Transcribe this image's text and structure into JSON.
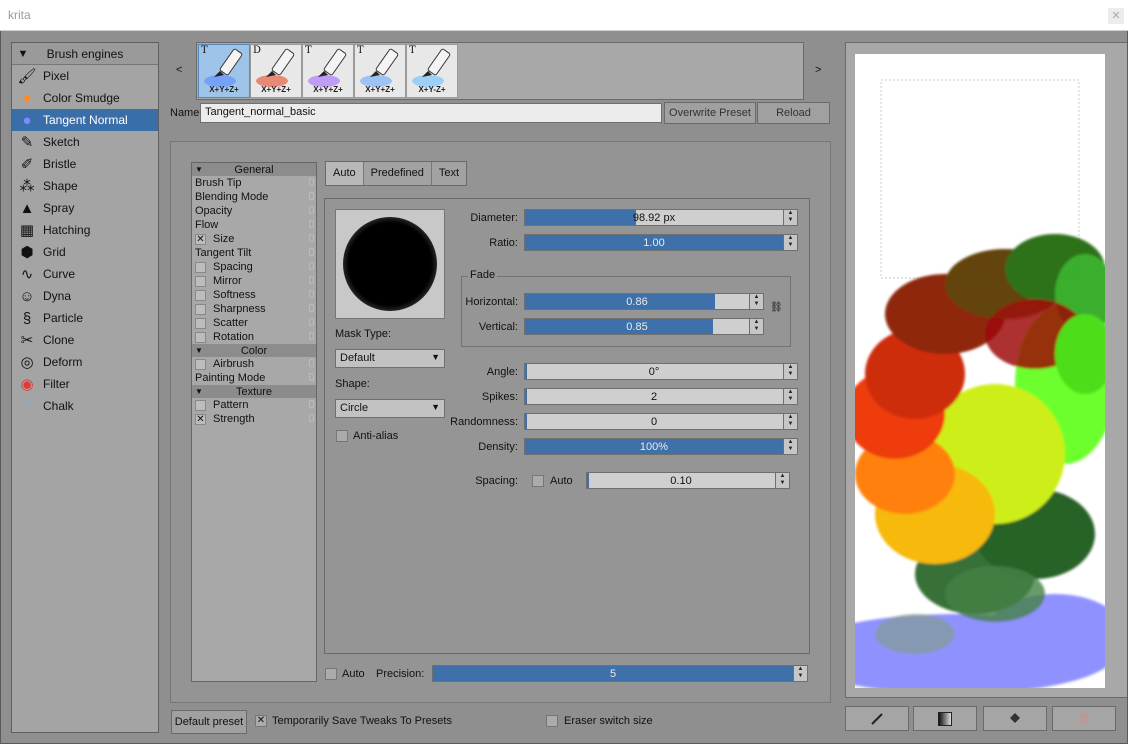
{
  "window": {
    "title": "krita"
  },
  "engines": {
    "header": "Brush engines",
    "items": [
      {
        "label": "Pixel",
        "icon": "pixel-brush-icon"
      },
      {
        "label": "Color Smudge",
        "icon": "color-smudge-icon"
      },
      {
        "label": "Tangent Normal",
        "icon": "tangent-normal-icon",
        "selected": true
      },
      {
        "label": "Sketch",
        "icon": "sketch-icon"
      },
      {
        "label": "Bristle",
        "icon": "bristle-icon"
      },
      {
        "label": "Shape",
        "icon": "shape-icon"
      },
      {
        "label": "Spray",
        "icon": "spray-icon"
      },
      {
        "label": "Hatching",
        "icon": "hatching-icon"
      },
      {
        "label": "Grid",
        "icon": "grid-icon"
      },
      {
        "label": "Curve",
        "icon": "curve-icon"
      },
      {
        "label": "Dyna",
        "icon": "dyna-icon"
      },
      {
        "label": "Particle",
        "icon": "particle-icon"
      },
      {
        "label": "Clone",
        "icon": "clone-icon"
      },
      {
        "label": "Deform",
        "icon": "deform-icon"
      },
      {
        "label": "Filter",
        "icon": "filter-icon"
      },
      {
        "label": "Chalk",
        "icon": "chalk-icon"
      }
    ]
  },
  "presets": {
    "prev": "<",
    "next": ">",
    "items": [
      {
        "tag": "T",
        "caption": "X+Y+Z+",
        "selected": true
      },
      {
        "tag": "D",
        "caption": "X+Y+Z+"
      },
      {
        "tag": "T",
        "caption": "X+Y+Z+"
      },
      {
        "tag": "T",
        "caption": "X+Y+Z+"
      },
      {
        "tag": "T",
        "caption": "X+Y-Z+"
      }
    ]
  },
  "name": {
    "label": "Name:",
    "value": "Tangent_normal_basic",
    "overwrite": "Overwrite Preset",
    "reload": "Reload"
  },
  "options": {
    "sections": [
      {
        "header": "General",
        "items": [
          {
            "label": "Brush Tip"
          },
          {
            "label": "Blending Mode"
          },
          {
            "label": "Opacity"
          },
          {
            "label": "Flow"
          },
          {
            "label": "Size",
            "checkbox": true,
            "checked": true
          },
          {
            "label": "Tangent Tilt"
          },
          {
            "label": "Spacing",
            "checkbox": true
          },
          {
            "label": "Mirror",
            "checkbox": true
          },
          {
            "label": "Softness",
            "checkbox": true
          },
          {
            "label": "Sharpness",
            "checkbox": true
          },
          {
            "label": "Scatter",
            "checkbox": true
          },
          {
            "label": "Rotation",
            "checkbox": true
          }
        ]
      },
      {
        "header": "Color",
        "items": [
          {
            "label": "Airbrush",
            "checkbox": true
          },
          {
            "label": "Painting Mode"
          }
        ]
      },
      {
        "header": "Texture",
        "items": [
          {
            "label": "Pattern",
            "checkbox": true
          },
          {
            "label": "Strength",
            "checkbox": true,
            "checked": true
          }
        ]
      }
    ]
  },
  "tabs": [
    "Auto",
    "Predefined",
    "Text"
  ],
  "tip": {
    "diameter": {
      "label": "Diameter:",
      "value": "98.92 px",
      "fraction": 0.43
    },
    "ratio": {
      "label": "Ratio:",
      "value": "1.00",
      "fraction": 1.0
    },
    "fade": {
      "title": "Fade",
      "horizontal": {
        "label": "Horizontal:",
        "value": "0.86",
        "fraction": 0.85
      },
      "vertical": {
        "label": "Vertical:",
        "value": "0.85",
        "fraction": 0.84
      }
    },
    "angle": {
      "label": "Angle:",
      "value": "0°",
      "fraction": 0.0
    },
    "spikes": {
      "label": "Spikes:",
      "value": "2",
      "fraction": 0.01
    },
    "randomness": {
      "label": "Randomness:",
      "value": "0",
      "fraction": 0.0
    },
    "density": {
      "label": "Density:",
      "value": "100%",
      "fraction": 1.0
    },
    "spacing": {
      "label": "Spacing:",
      "auto": "Auto",
      "value": "0.10",
      "fraction": 0.01
    },
    "mask_type": {
      "label": "Mask Type:",
      "value": "Default"
    },
    "shape": {
      "label": "Shape:",
      "value": "Circle"
    },
    "antialias": "Anti-alias"
  },
  "precision": {
    "auto": "Auto",
    "label": "Precision:",
    "value": "5",
    "fraction": 1.0
  },
  "bottom": {
    "default_preset": "Default preset",
    "save_tweaks": "Temporarily Save Tweaks To Presets",
    "eraser": "Eraser switch size"
  },
  "colors": {
    "accent": "#3e71aa",
    "selection": "#3a6ea8",
    "scratch_blue": "#8a8cff"
  }
}
